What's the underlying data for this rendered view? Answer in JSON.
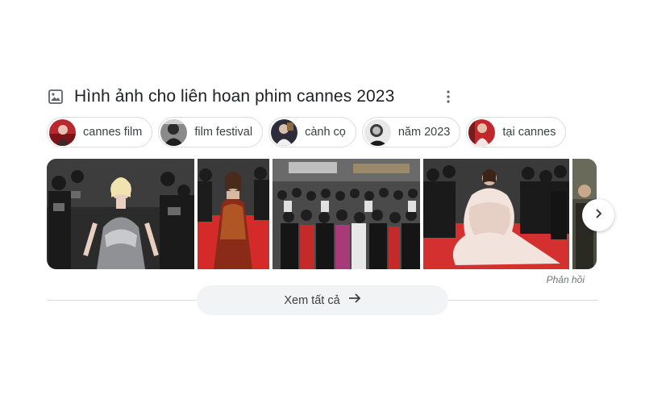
{
  "section": {
    "title": "Hình ảnh cho liên hoan phim cannes 2023",
    "icon": "image-icon",
    "more_icon": "more-vert-icon"
  },
  "chips": [
    {
      "label": "cannes film",
      "thumb_color": "#b8282e"
    },
    {
      "label": "film festival",
      "thumb_color": "#4a4a4a"
    },
    {
      "label": "cành cọ",
      "thumb_color": "#2c2c3a"
    },
    {
      "label": "năm 2023",
      "thumb_color": "#9a9a9a"
    },
    {
      "label": "tại cannes",
      "thumb_color": "#c0282c"
    }
  ],
  "carousel": {
    "next_icon": "chevron-right-icon"
  },
  "feedback": {
    "label": "Phản hồi"
  },
  "see_all": {
    "label": "Xem tất cả",
    "icon": "arrow-right-icon"
  },
  "colors": {
    "chip_border": "#dadce0",
    "button_bg": "#f1f3f4",
    "text": "#202124"
  }
}
